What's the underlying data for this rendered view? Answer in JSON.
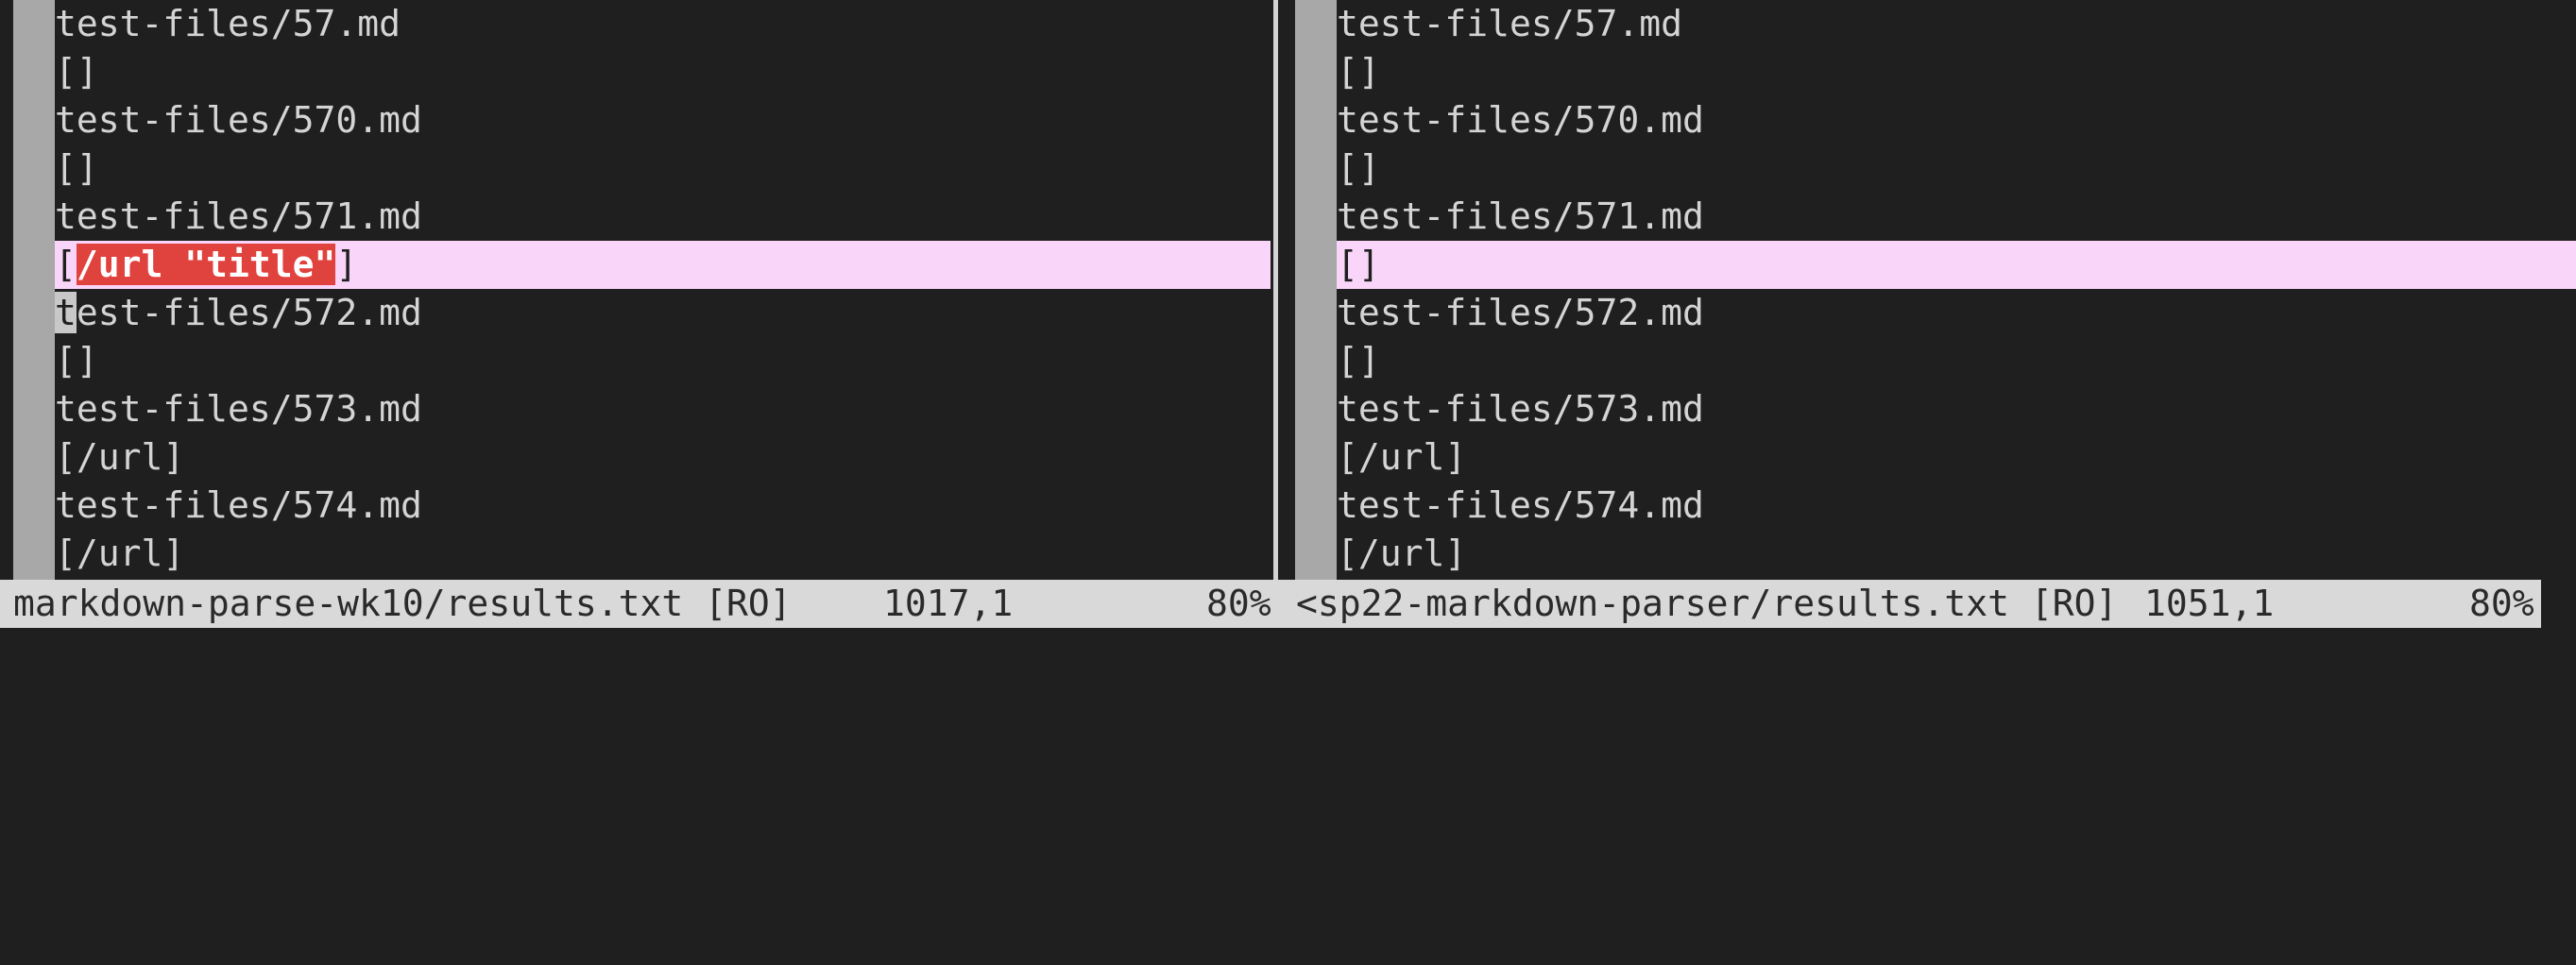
{
  "left_pane": {
    "lines": [
      "test-files/57.md",
      "[]",
      "test-files/570.md",
      "[]",
      "test-files/571.md",
      "[/url \"title\"]",
      "test-files/572.md",
      "[]",
      "test-files/573.md",
      "[/url]",
      "test-files/574.md",
      "[/url]"
    ],
    "changed_line": {
      "open": "[",
      "diff": "/url \"title\"",
      "close": "]"
    },
    "cursor_line": {
      "cursor_char": "t",
      "rest": "est-files/572.md"
    }
  },
  "right_pane": {
    "lines": [
      "test-files/57.md",
      "[]",
      "test-files/570.md",
      "[]",
      "test-files/571.md",
      "[]",
      "test-files/572.md",
      "[]",
      "test-files/573.md",
      "[/url]",
      "test-files/574.md",
      "[/url]"
    ]
  },
  "status": {
    "left_file": "markdown-parse-wk10/results.txt [RO]",
    "left_pos": "1017,1",
    "left_pct": "80%",
    "right_file": "<sp22-markdown-parser/results.txt [RO]",
    "right_pos": "1051,1",
    "right_pct": "80%"
  },
  "colors": {
    "background": "#1f1f1f",
    "foreground": "#d4d4d4",
    "gutter": "#a8a8a8",
    "diff_change_line": "#f9d5f9",
    "diff_text": "#e0423e",
    "statusline": "#d9d9d9"
  }
}
